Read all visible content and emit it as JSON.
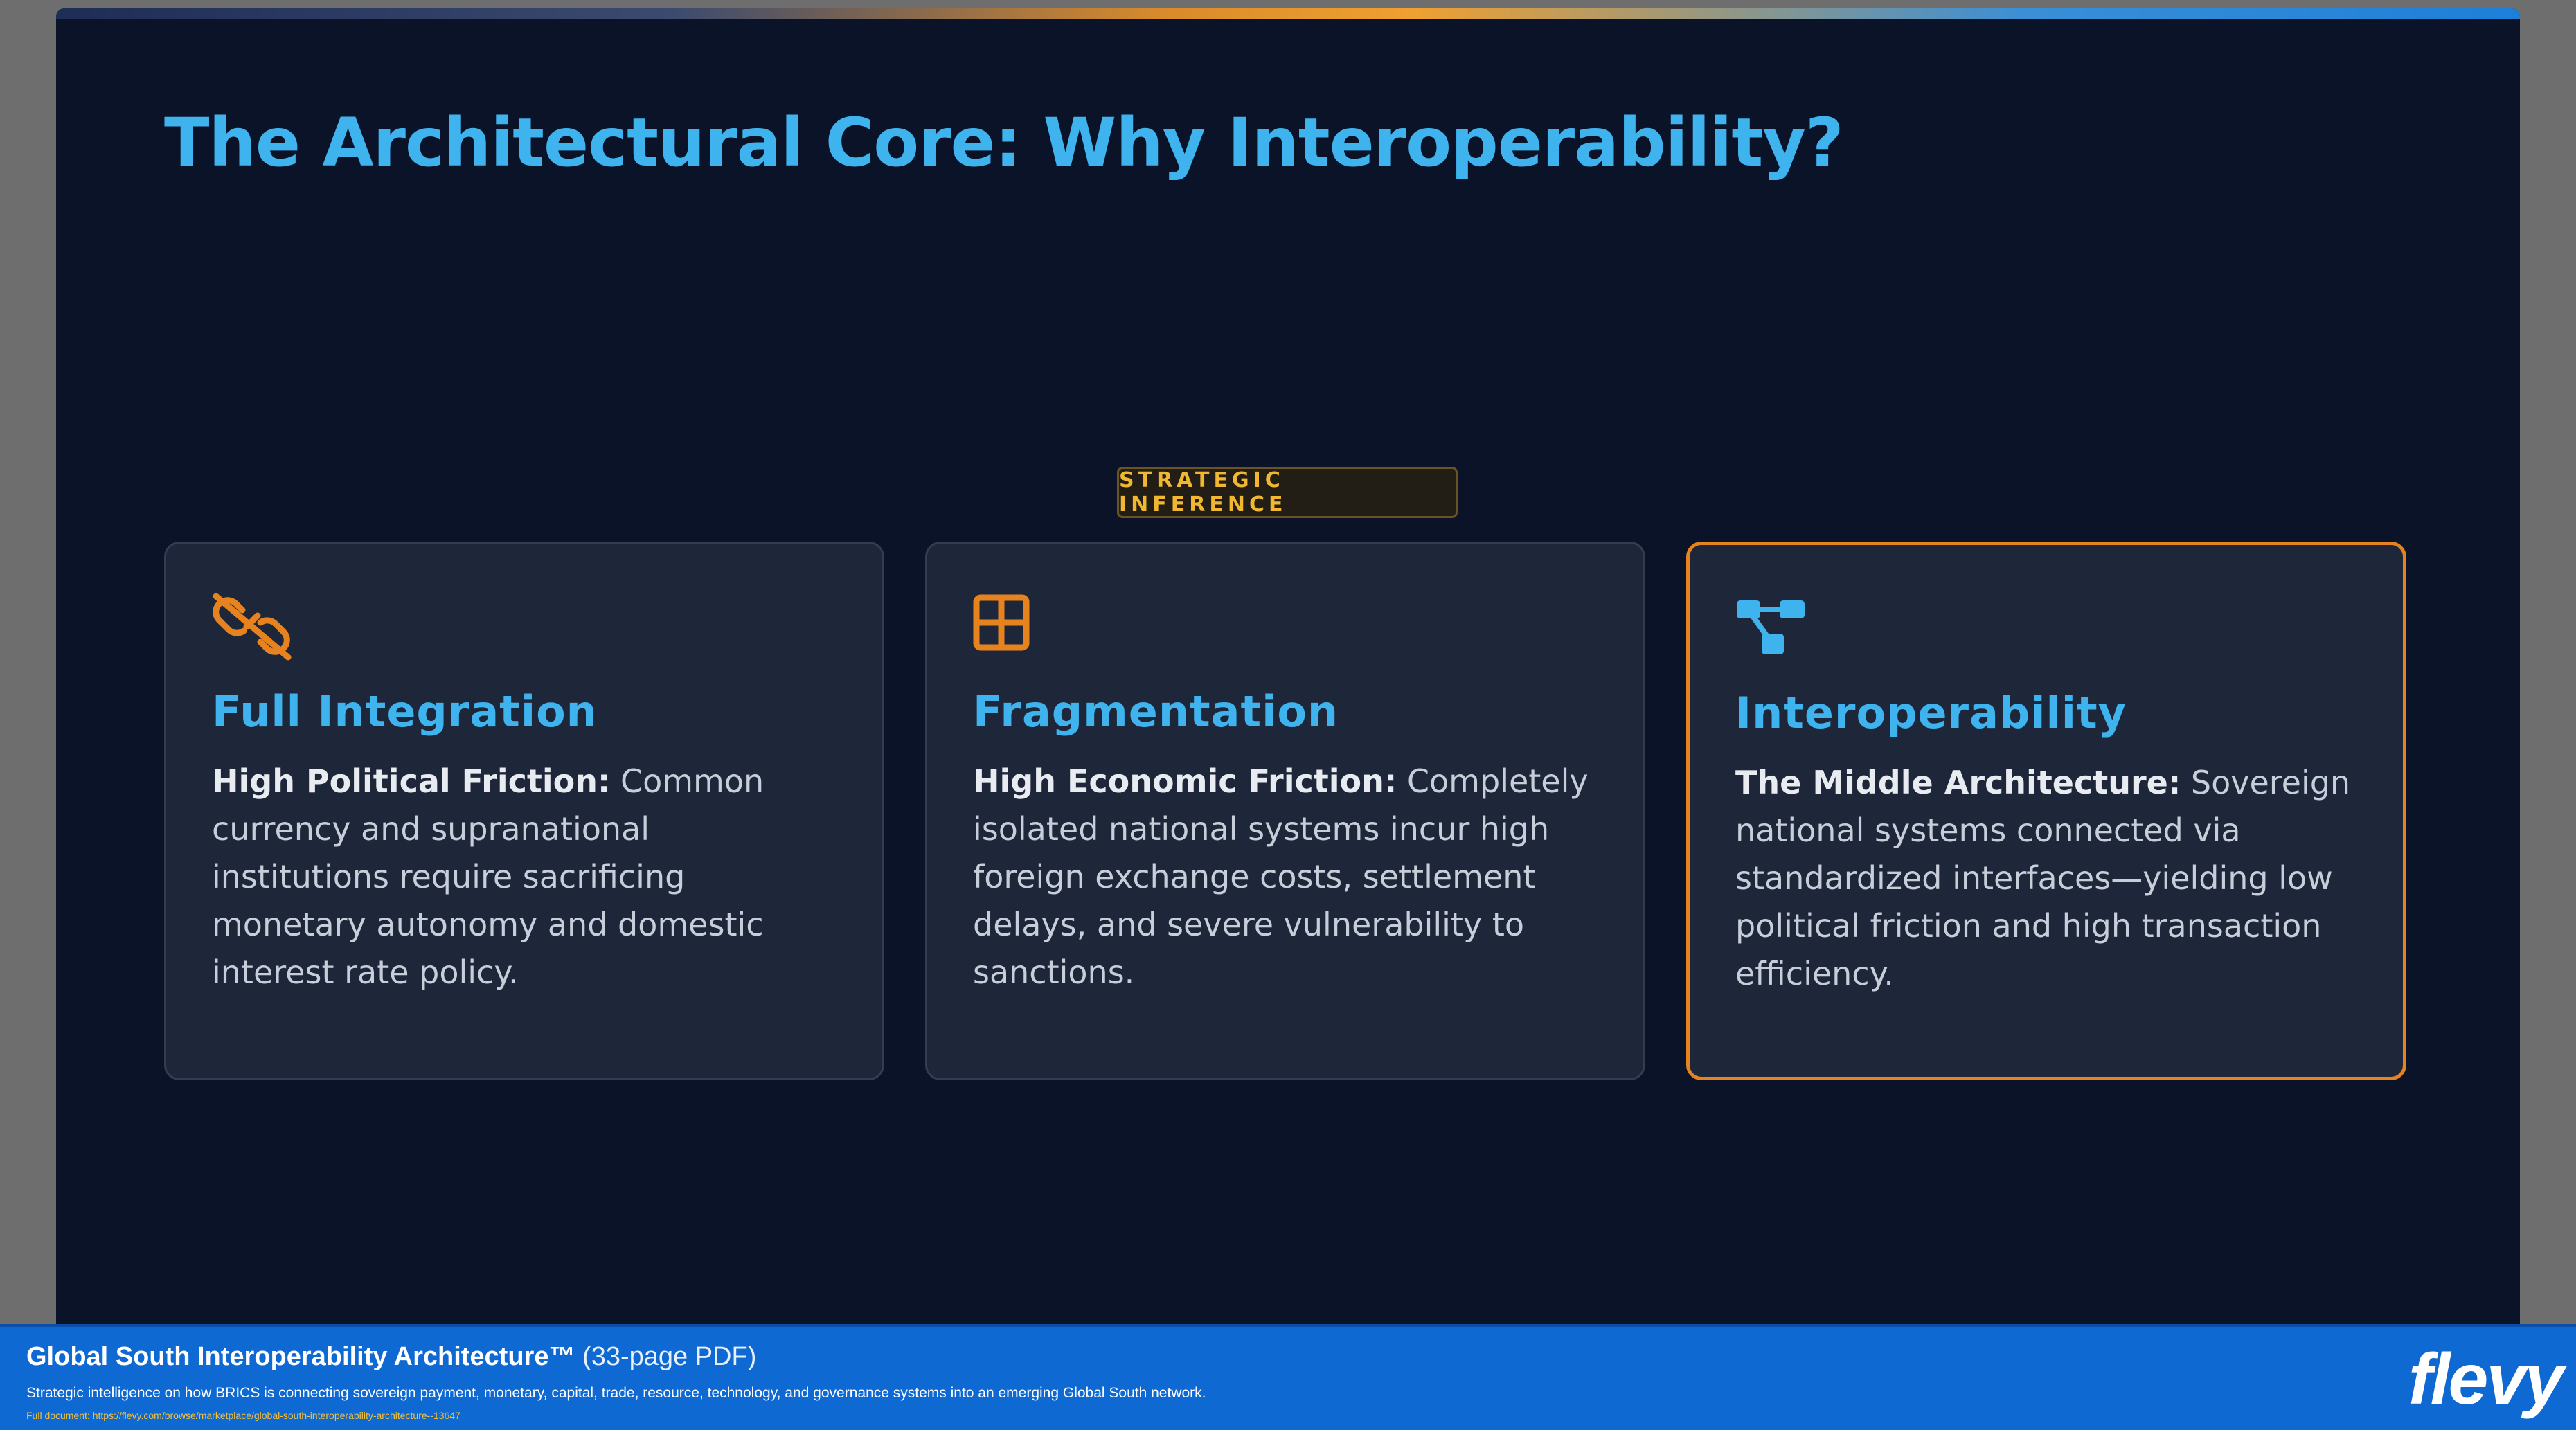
{
  "slide": {
    "title": "The Architectural Core: Why Interoperability?",
    "badge": "STRATEGIC INFERENCE",
    "cards": [
      {
        "icon": "unlink-icon",
        "icon_color": "#e7831f",
        "heading": "Full Integration",
        "lead": "High Political Friction:",
        "body": " Common currency and supranational institutions require sacrificing monetary autonomy and domestic interest rate policy."
      },
      {
        "icon": "grid-icon",
        "icon_color": "#e7831f",
        "heading": "Fragmentation",
        "lead": "High Economic Friction:",
        "body": " Completely isolated national systems incur high foreign exchange costs, settlement delays, and severe vulnerability to sanctions."
      },
      {
        "icon": "network-icon",
        "icon_color": "#3fb3ee",
        "heading": "Interoperability",
        "lead": "The Middle Architecture:",
        "body": " Sovereign national systems connected via standardized interfaces—yielding low political friction and high transaction efficiency.",
        "highlighted": true
      }
    ]
  },
  "footer": {
    "title": "Global South Interoperability Architecture™",
    "pages": " (33-page PDF)",
    "description": "Strategic intelligence on how BRICS is connecting sovereign payment, monetary, capital, trade, resource, technology, and governance systems into an emerging Global South network.",
    "link_label": "Full document: https://flevy.com/browse/marketplace/global-south-interoperability-architecture--13647",
    "logo": "flevy"
  },
  "colors": {
    "slide_background": "#0b1329",
    "card_background": "#1e273a",
    "accent_blue": "#3fb3ee",
    "accent_orange": "#e7831f",
    "badge_text": "#f1b730",
    "footer_background": "#0f69d2"
  }
}
